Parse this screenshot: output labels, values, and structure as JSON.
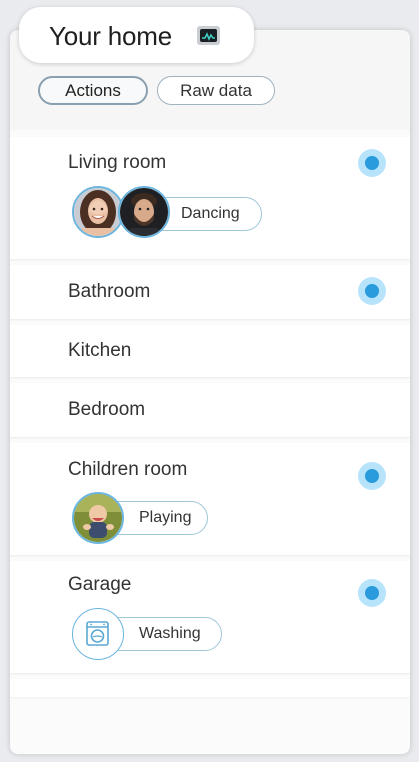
{
  "header": {
    "title": "Your home",
    "icon": "monitor-icon"
  },
  "tabs": [
    {
      "label": "Actions",
      "active": true
    },
    {
      "label": "Raw data",
      "active": false
    }
  ],
  "rooms": [
    {
      "name": "Living room",
      "active": true,
      "activity": "Dancing",
      "avatars": [
        "woman-avatar",
        "man-avatar"
      ]
    },
    {
      "name": "Bathroom",
      "active": true
    },
    {
      "name": "Kitchen",
      "active": false
    },
    {
      "name": "Bedroom",
      "active": false
    },
    {
      "name": "Children room",
      "active": true,
      "activity": "Playing",
      "avatars": [
        "baby-avatar"
      ]
    },
    {
      "name": "Garage",
      "active": true,
      "activity": "Washing",
      "avatars": [
        "washing-machine-icon"
      ]
    }
  ],
  "colors": {
    "indicator": "#2a9bdc",
    "indicator_halo": "#b7e3fb",
    "accent_border": "#6bb5df"
  }
}
